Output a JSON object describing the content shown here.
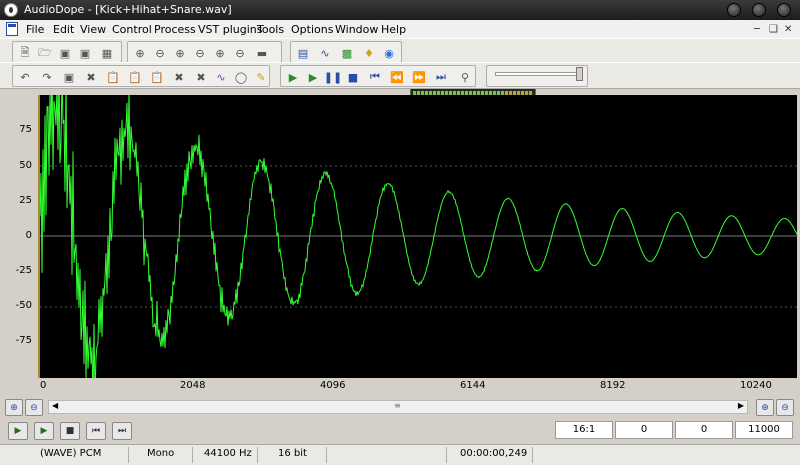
{
  "window": {
    "title": "AudioDope - [Kick+Hihat+Snare.wav]"
  },
  "menu": [
    "File",
    "Edit",
    "View",
    "Control",
    "Process",
    "VST plugins",
    "Tools",
    "Options",
    "Window",
    "Help"
  ],
  "waveform": {
    "y_ticks": [
      "75",
      "50",
      "25",
      "0",
      "-25",
      "-50",
      "-75"
    ],
    "x_ticks": [
      "0",
      "2048",
      "4096",
      "6144",
      "8192",
      "10240"
    ],
    "colors": {
      "background": "#000000",
      "wave": "#33ff33",
      "axis": "#a58a2f"
    }
  },
  "position": {
    "zoom": "16:1",
    "start": "0",
    "length": "0",
    "end": "11000"
  },
  "status": {
    "format": "(WAVE) PCM",
    "channels": "Mono",
    "sample_rate": "44100 Hz",
    "bit_depth": "16 bit",
    "time": "00:00:00,249"
  }
}
